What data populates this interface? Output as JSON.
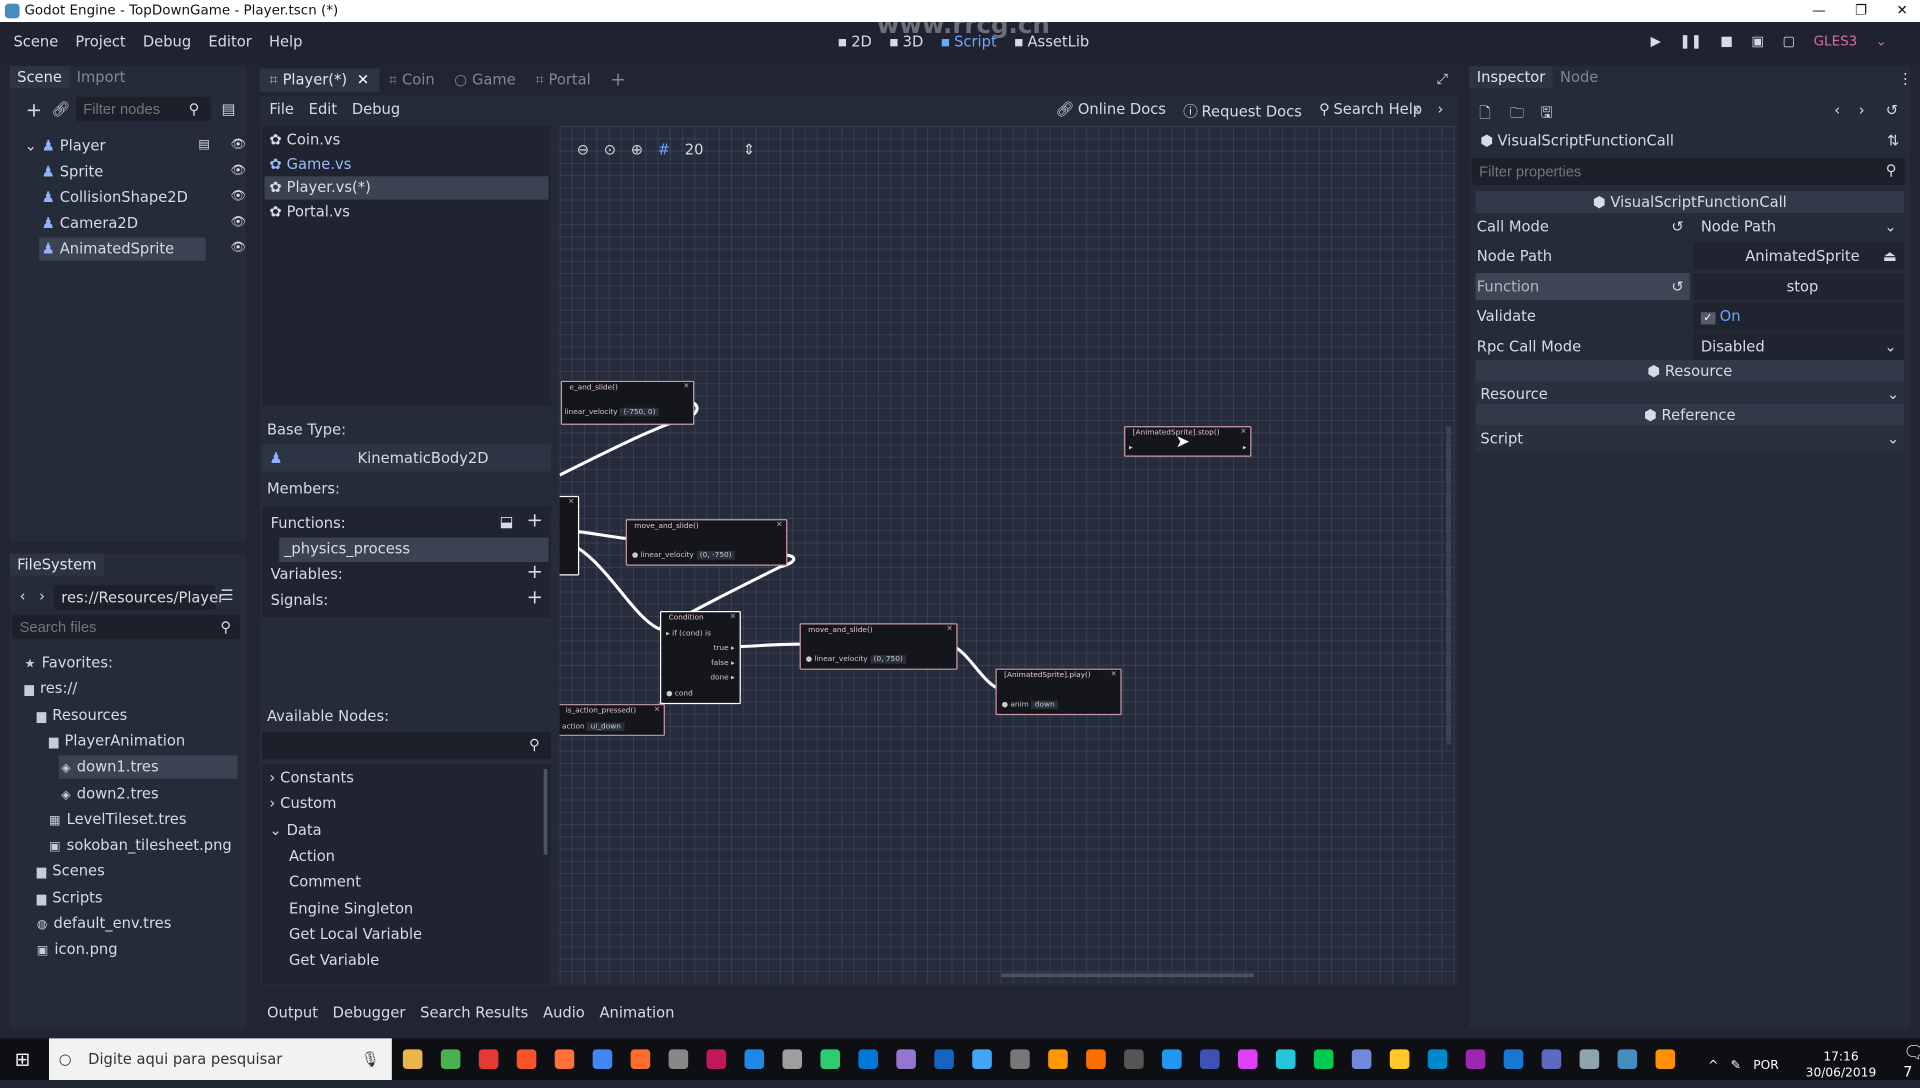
{
  "window": {
    "title": "Godot Engine - TopDownGame - Player.tscn (*)",
    "controls": [
      "—",
      "❐",
      "✕"
    ]
  },
  "menu": [
    "Scene",
    "Project",
    "Debug",
    "Editor",
    "Help"
  ],
  "modes": [
    {
      "label": "2D",
      "icon": "2d-icon"
    },
    {
      "label": "3D",
      "icon": "3d-icon"
    },
    {
      "label": "Script",
      "icon": "script-icon",
      "active": true
    },
    {
      "label": "AssetLib",
      "icon": "assetlib-icon"
    }
  ],
  "play": {
    "renderer": "GLES3"
  },
  "watermark": "www.rrcg.cn",
  "scene_dock": {
    "tabs": [
      "Scene",
      "Import"
    ],
    "filter_placeholder": "Filter nodes",
    "tree": [
      {
        "label": "Player",
        "depth": 0,
        "script": true
      },
      {
        "label": "Sprite",
        "depth": 1
      },
      {
        "label": "CollisionShape2D",
        "depth": 1
      },
      {
        "label": "Camera2D",
        "depth": 1
      },
      {
        "label": "AnimatedSprite",
        "depth": 1,
        "selected": true
      }
    ]
  },
  "filesystem": {
    "tab": "FileSystem",
    "path": "res://Resources/Player",
    "search_placeholder": "Search files",
    "tree": [
      {
        "label": "Favorites:",
        "depth": 0,
        "icon": "star-icon"
      },
      {
        "label": "res://",
        "depth": 0,
        "icon": "folder-icon"
      },
      {
        "label": "Resources",
        "depth": 1,
        "icon": "folder-icon"
      },
      {
        "label": "PlayerAnimation",
        "depth": 2,
        "icon": "folder-icon"
      },
      {
        "label": "down1.tres",
        "depth": 3,
        "icon": "resource-icon",
        "selected": true
      },
      {
        "label": "down2.tres",
        "depth": 3,
        "icon": "resource-icon"
      },
      {
        "label": "LevelTileset.tres",
        "depth": 2,
        "icon": "tileset-icon"
      },
      {
        "label": "sokoban_tilesheet.png",
        "depth": 2,
        "icon": "image-icon"
      },
      {
        "label": "Scenes",
        "depth": 1,
        "icon": "folder-icon"
      },
      {
        "label": "Scripts",
        "depth": 1,
        "icon": "folder-icon"
      },
      {
        "label": "default_env.tres",
        "depth": 1,
        "icon": "env-icon"
      },
      {
        "label": "icon.png",
        "depth": 1,
        "icon": "image-icon"
      }
    ]
  },
  "scene_tabs": [
    "Player(*)",
    "Coin",
    "Game",
    "Portal"
  ],
  "script_editor": {
    "menu": [
      "File",
      "Edit",
      "Debug"
    ],
    "help": [
      "Online Docs",
      "Request Docs",
      "Search Help"
    ],
    "scripts": [
      {
        "label": "Coin.vs"
      },
      {
        "label": "Game.vs",
        "link": true
      },
      {
        "label": "Player.vs(*)",
        "selected": true
      },
      {
        "label": "Portal.vs"
      }
    ],
    "base_type_label": "Base Type:",
    "base_type": "KinematicBody2D",
    "members_label": "Members:",
    "functions_label": "Functions:",
    "function": "_physics_process",
    "variables_label": "Variables:",
    "signals_label": "Signals:",
    "available_nodes_label": "Available Nodes:",
    "available_nodes": [
      {
        "label": "Constants",
        "depth": 0,
        "arrow": "›"
      },
      {
        "label": "Custom",
        "depth": 0,
        "arrow": "›"
      },
      {
        "label": "Data",
        "depth": 0,
        "arrow": "⌄"
      },
      {
        "label": "Action",
        "depth": 1
      },
      {
        "label": "Comment",
        "depth": 1
      },
      {
        "label": "Engine Singleton",
        "depth": 1
      },
      {
        "label": "Get Local Variable",
        "depth": 1
      },
      {
        "label": "Get Variable",
        "depth": 1
      }
    ],
    "zoom": "20"
  },
  "graph_nodes": {
    "n1": {
      "title": "e_and_slide()",
      "param": "linear_velocity",
      "value": "(-750, 0)",
      "type": "vec2"
    },
    "n3": {
      "title": "move_and_slide()",
      "param": "linear_velocity",
      "value": "(0, -750)",
      "type": "vec2"
    },
    "cond": {
      "title": "Condition",
      "rows": [
        "if (cond) is",
        "true",
        "false",
        "done"
      ],
      "param": "cond",
      "type": "bool"
    },
    "action": {
      "title": "is_action_pressed()",
      "param": "action",
      "value": "ui_down",
      "type": "bool"
    },
    "n6": {
      "title": "move_and_slide()",
      "param": "linear_velocity",
      "value": "(0, 750)",
      "type": "vec2"
    },
    "play": {
      "title": "[AnimatedSprite].play()",
      "param": "anim",
      "value": "down",
      "type": "str"
    },
    "stop": {
      "title": "[AnimatedSprite].stop()"
    }
  },
  "bottom_tabs": [
    "Output",
    "Debugger",
    "Search Results",
    "Audio",
    "Animation"
  ],
  "inspector": {
    "tabs": [
      "Inspector",
      "Node"
    ],
    "object": "VisualScriptFunctionCall",
    "filter_placeholder": "Filter properties",
    "section": "VisualScriptFunctionCall",
    "props": [
      {
        "label": "Call Mode",
        "value": "Node Path"
      },
      {
        "label": "Node Path",
        "value": "AnimatedSprite"
      },
      {
        "label": "Function",
        "value": "stop"
      },
      {
        "label": "Validate",
        "value": "On"
      },
      {
        "label": "Rpc Call Mode",
        "value": "Disabled"
      }
    ],
    "resource_section": "Resource",
    "resource": "Resource",
    "reference_section": "Reference",
    "script": "Script"
  },
  "taskbar": {
    "search_placeholder": "Digite aqui para pesquisar",
    "lang": "POR",
    "time": "17:16",
    "date": "30/06/2019",
    "notifications": "7"
  },
  "colors": {
    "accent": "#6aa5ff",
    "node_border": "#c99aa8",
    "canvas": "#262c3b",
    "renderer": "#d46fa8"
  }
}
